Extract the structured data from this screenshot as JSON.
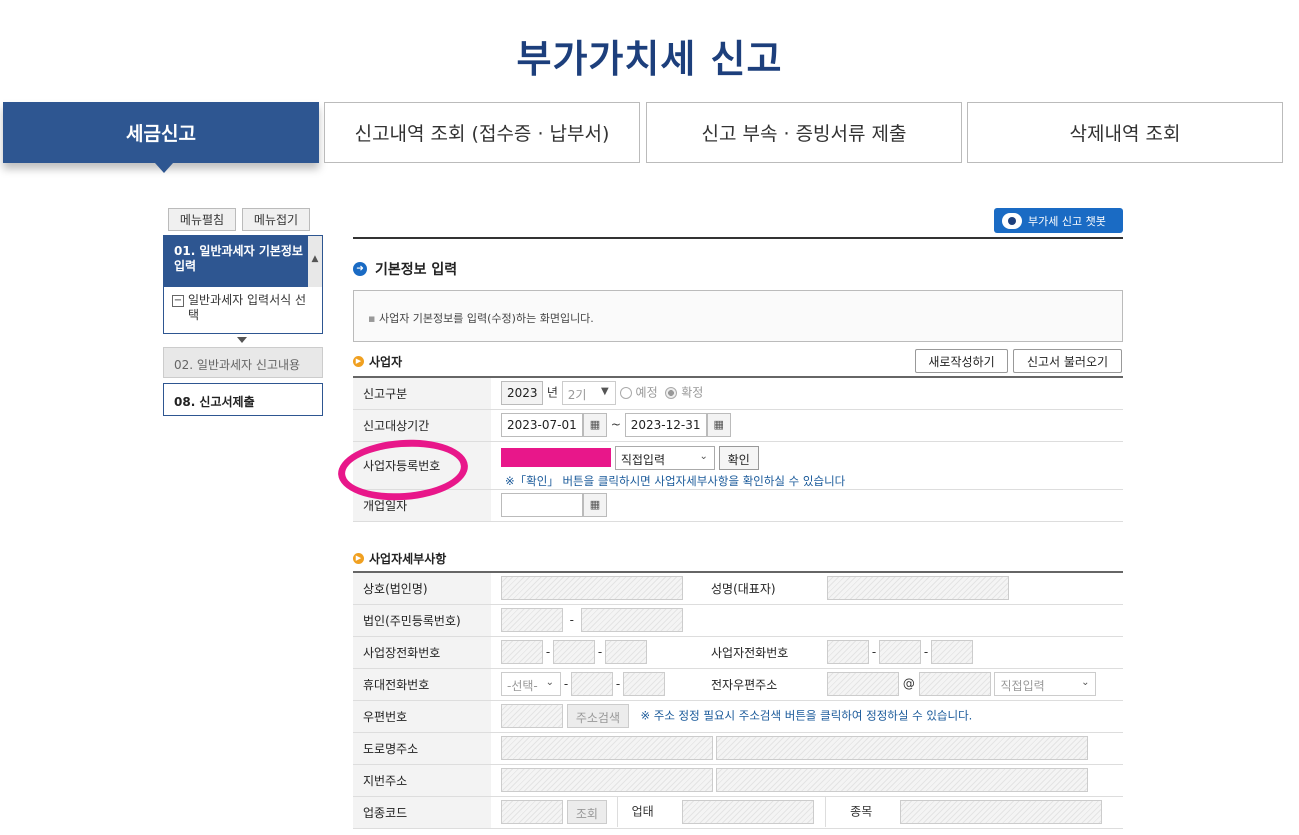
{
  "page": {
    "title": "부가가치세 신고"
  },
  "tabs": [
    {
      "label": "세금신고"
    },
    {
      "label": "신고내역 조회 (접수증 · 납부서)"
    },
    {
      "label": "신고 부속 · 증빙서류 제출"
    },
    {
      "label": "삭제내역 조회"
    }
  ],
  "sidebar": {
    "expand_label": "메뉴펼침",
    "collapse_label": "메뉴접기",
    "steps": [
      {
        "label": "01. 일반과세자 기본정보 입력",
        "sub": "일반과세자 입력서식 선택"
      },
      {
        "label": "02. 일반과세자 신고내용"
      },
      {
        "label": "08. 신고서제출"
      }
    ]
  },
  "chatbot": {
    "label": "부가세 신고 챗봇"
  },
  "basic": {
    "title": "기본정보 입력",
    "info": "사업자 기본정보를 입력(수정)하는 화면입니다."
  },
  "biz": {
    "title": "사업자",
    "new_button": "새로작성하기",
    "load_button": "신고서 불러오기",
    "rows": {
      "report_type": "신고구분",
      "period": "신고대상기간",
      "reg_no": "사업자등록번호",
      "open_date": "개업일자"
    },
    "year": "2023",
    "year_unit": "년",
    "term": "2기",
    "radio_planned": "예정",
    "radio_confirmed": "확정",
    "start_date": "2023-07-01",
    "tilde": "~",
    "end_date": "2023-12-31",
    "input_mode": "직접입력",
    "confirm_button": "확인",
    "reg_note": "※「확인」 버튼을 클릭하시면 사업자세부사항을 확인하실 수 있습니다"
  },
  "detail": {
    "title": "사업자세부사항",
    "labels": {
      "company": "상호(법인명)",
      "ceo": "성명(대표자)",
      "corp_no": "법인(주민등록번호)",
      "office_phone": "사업장전화번호",
      "biz_phone": "사업자전화번호",
      "mobile": "휴대전화번호",
      "email": "전자우편주소",
      "zip": "우편번호",
      "road_addr": "도로명주소",
      "lot_addr": "지번주소",
      "industry_code": "업종코드",
      "business_type": "업태",
      "item": "종목"
    },
    "select_placeholder": "-선택-",
    "at": "@",
    "email_mode": "직접입력",
    "address_search": "주소검색",
    "zip_note": "※ 주소 정정 필요시 주소검색 버튼을 클릭하여 정정하실 수 있습니다.",
    "lookup": "조회",
    "dash": "-"
  },
  "colors": {
    "brand": "#2e5691",
    "title": "#1d3f7c",
    "annotation": "#e8178a"
  }
}
